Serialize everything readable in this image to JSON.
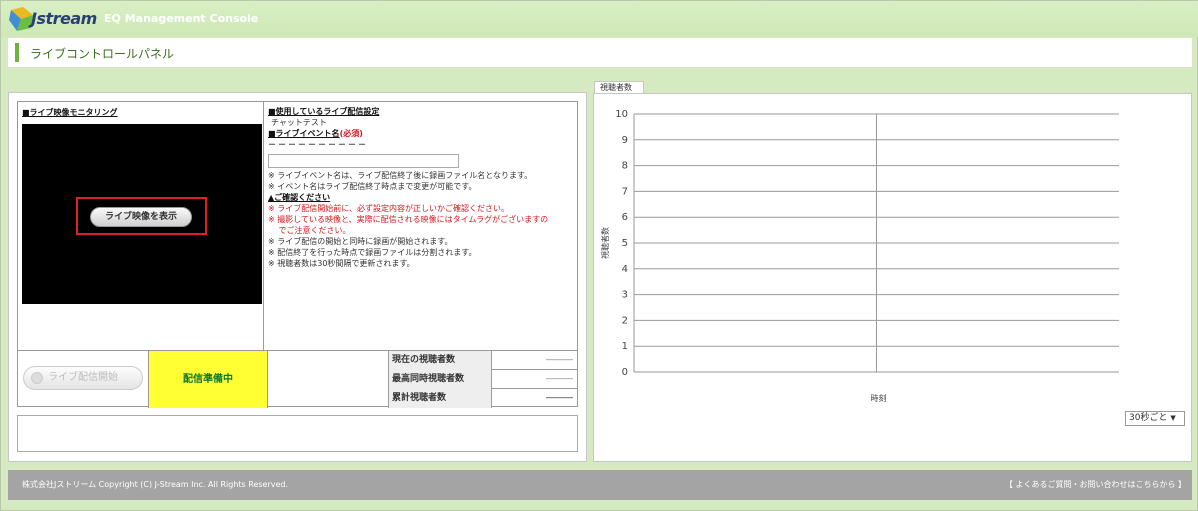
{
  "header": {
    "logo_text": "Jstream",
    "app_title": "EQ Management Console",
    "accent_color": "#6cb33f"
  },
  "panel": {
    "title": "ライブコントロールパネル"
  },
  "monitor": {
    "heading": "■ライブ映像モニタリング",
    "show_video_label": "ライブ映像を表示"
  },
  "settings": {
    "config_heading": "■使用しているライブ配信設定",
    "config_value": "チャットテスト",
    "event_name_heading": "■ライブイベント名",
    "required_label": "(必須)",
    "event_name_placeholder_dashes": "－－－－－－－－－－",
    "event_name_value": "",
    "notes": [
      "※ ライブイベント名は、ライブ配信終了後に録画ファイル名となります。",
      "※ イベント名はライブ配信終了時点まで変更が可能です。"
    ],
    "confirm_heading": "▲ご確認ください",
    "warnings": [
      "※ ライブ配信開始前に、必ず設定内容が正しいかご確認ください。",
      "※ 撮影している映像と、実際に配信される映像にはタイムラグがございますの",
      "　 でご注意ください。"
    ],
    "info": [
      "※ ライブ配信の開始と同時に録画が開始されます。",
      "※ 配信終了を行った時点で録画ファイルは分割されます。",
      "※ 視聴者数は30秒間隔で更新されます。"
    ]
  },
  "status": {
    "start_button_label": "ライブ配信開始",
    "state_label": "配信準備中",
    "state_color": "#ffff33",
    "counts": [
      {
        "label": "現在の視聴者数",
        "value": "―――"
      },
      {
        "label": "最高同時視聴者数",
        "value": "―――"
      },
      {
        "label": "累計視聴者数",
        "value": "―――"
      }
    ]
  },
  "viewer_chart": {
    "tab_label": "視聴者数",
    "interval_option": "30秒ごと",
    "interval_arrow": "▼"
  },
  "chart_data": {
    "type": "line",
    "title": "",
    "xlabel": "時刻",
    "ylabel": "視聴者数",
    "ylim": [
      0,
      10
    ],
    "y_ticks": [
      0,
      1,
      2,
      3,
      4,
      5,
      6,
      7,
      8,
      9,
      10
    ],
    "x": [],
    "series": [],
    "grid": true
  },
  "footer": {
    "copyright": "株式会社Jストリーム Copyright (C) J-Stream Inc. All Rights Reserved.",
    "contact_link": "【 よくあるご質問・お問い合わせはこちらから 】"
  }
}
